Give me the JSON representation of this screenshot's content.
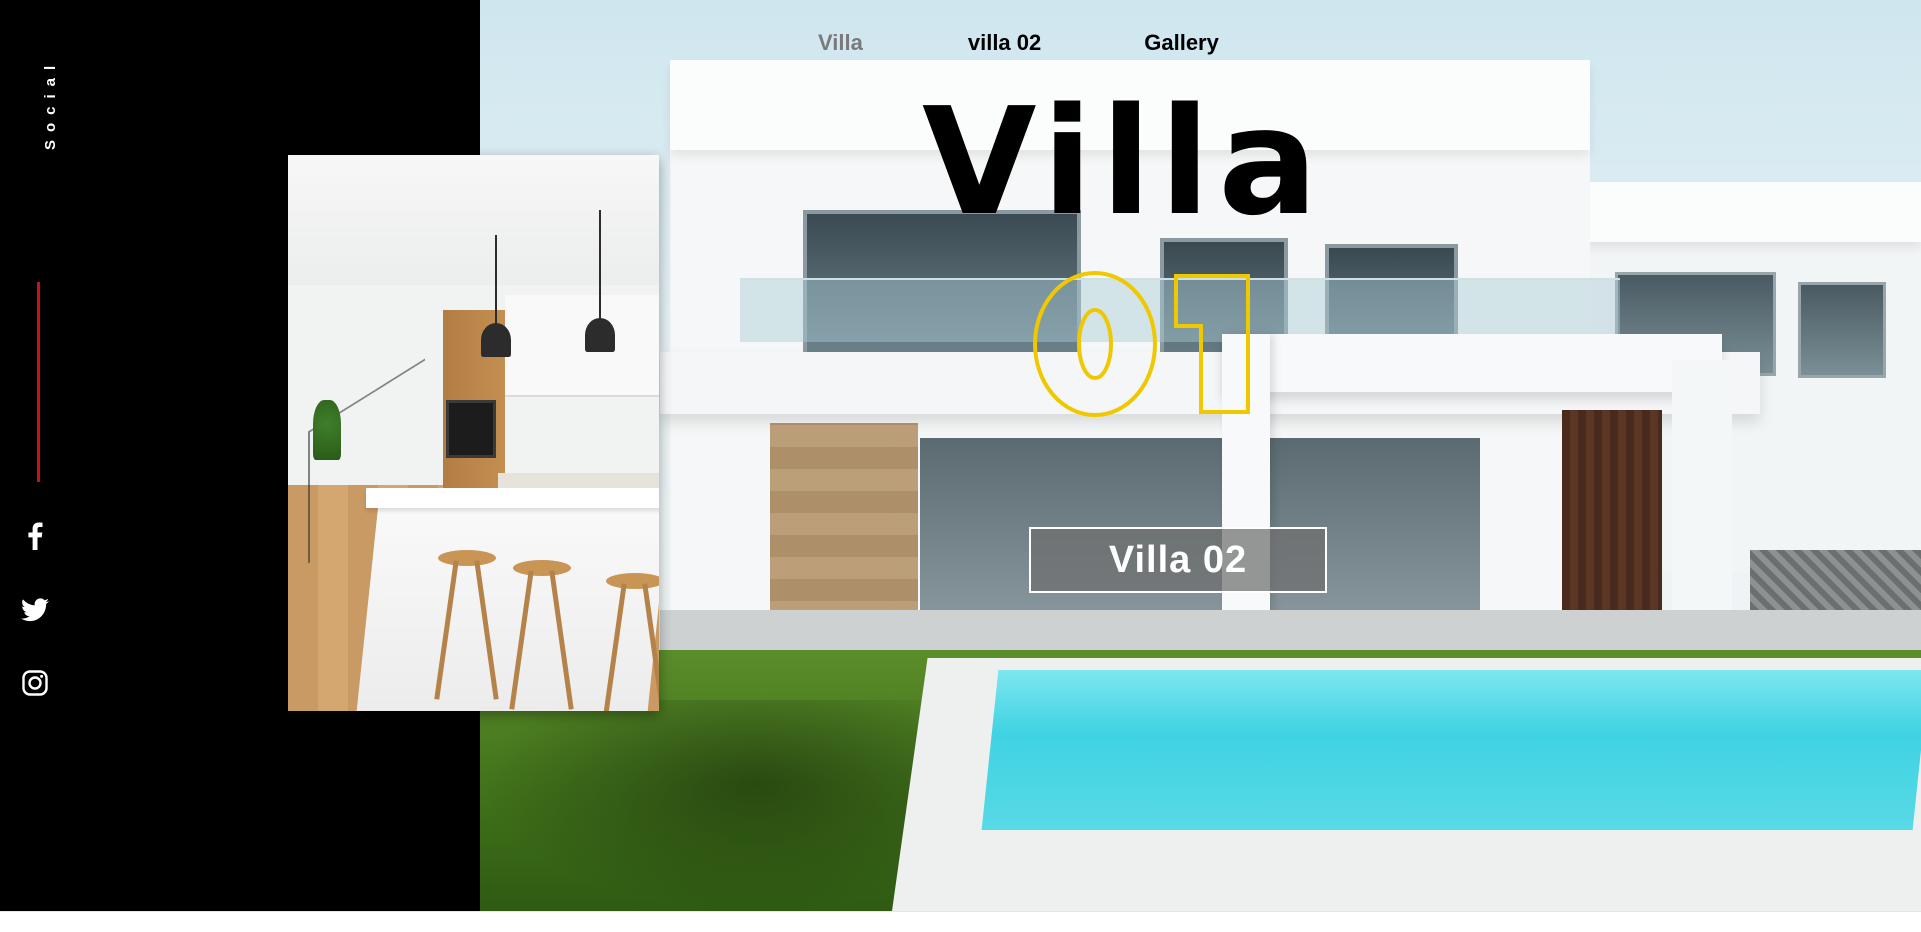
{
  "nav": {
    "items": [
      {
        "label": "Villa",
        "active": true
      },
      {
        "label": "villa 02",
        "active": false
      },
      {
        "label": "Gallery",
        "active": false
      }
    ]
  },
  "sidebar": {
    "social_label": "Social",
    "icons": [
      "facebook-icon",
      "twitter-icon",
      "instagram-icon"
    ],
    "accent_line_color": "#c8101e"
  },
  "hero": {
    "title": "Villa",
    "number": "01",
    "number_color": "#f0c800",
    "badge": "Villa 02"
  }
}
